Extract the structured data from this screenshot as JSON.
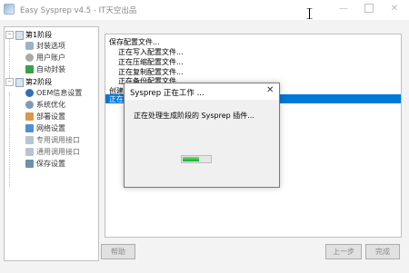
{
  "window": {
    "title": "Easy Sysprep v4.5 - IT天空出品"
  },
  "tree": {
    "groups": [
      {
        "label": "第1阶段",
        "toggle": "−",
        "items": [
          {
            "label": "封装选项",
            "icon": "wrench-icon",
            "color": "#7b8ea3"
          },
          {
            "label": "用户账户",
            "icon": "user-icon",
            "color": "#8c8c8c"
          },
          {
            "label": "自动封装",
            "icon": "play-icon",
            "color": "#3aa04a"
          }
        ]
      },
      {
        "label": "第2阶段",
        "toggle": "−",
        "items": [
          {
            "label": "OEM信息设置",
            "icon": "info-icon",
            "color": "#2f6fb8"
          },
          {
            "label": "系统优化",
            "icon": "gear-icon",
            "color": "#6f8ea8"
          },
          {
            "label": "部署设置",
            "icon": "deploy-icon",
            "color": "#c97f2b"
          },
          {
            "label": "网络设置",
            "icon": "network-icon",
            "color": "#3d7fbf"
          },
          {
            "label": "专用调用接口",
            "icon": "interface-icon",
            "color": "#8aa0b5"
          },
          {
            "label": "通用调用接口",
            "icon": "interface-icon",
            "color": "#8aa0b5"
          },
          {
            "label": "保存设置",
            "icon": "save-icon",
            "color": "#5f7f9f"
          }
        ]
      }
    ]
  },
  "log": {
    "lines": [
      {
        "text": "保存配置文件...",
        "indent": false
      },
      {
        "text": "正在写入配置文件...",
        "indent": true
      },
      {
        "text": "正在压缩配置文件...",
        "indent": true
      },
      {
        "text": "正在复制配置文件...",
        "indent": true
      },
      {
        "text": "正在备份配置文件...",
        "indent": true
      },
      {
        "text": "创建",
        "indent": false
      }
    ],
    "selected": "正在"
  },
  "buttons": {
    "help": "帮助",
    "prev": "上一步",
    "next": "完成"
  },
  "dialog": {
    "title": "Sysprep 正在工作 ...",
    "message": "正在处理生成阶段的 Sysprep 插件...",
    "progress": 0.6
  }
}
